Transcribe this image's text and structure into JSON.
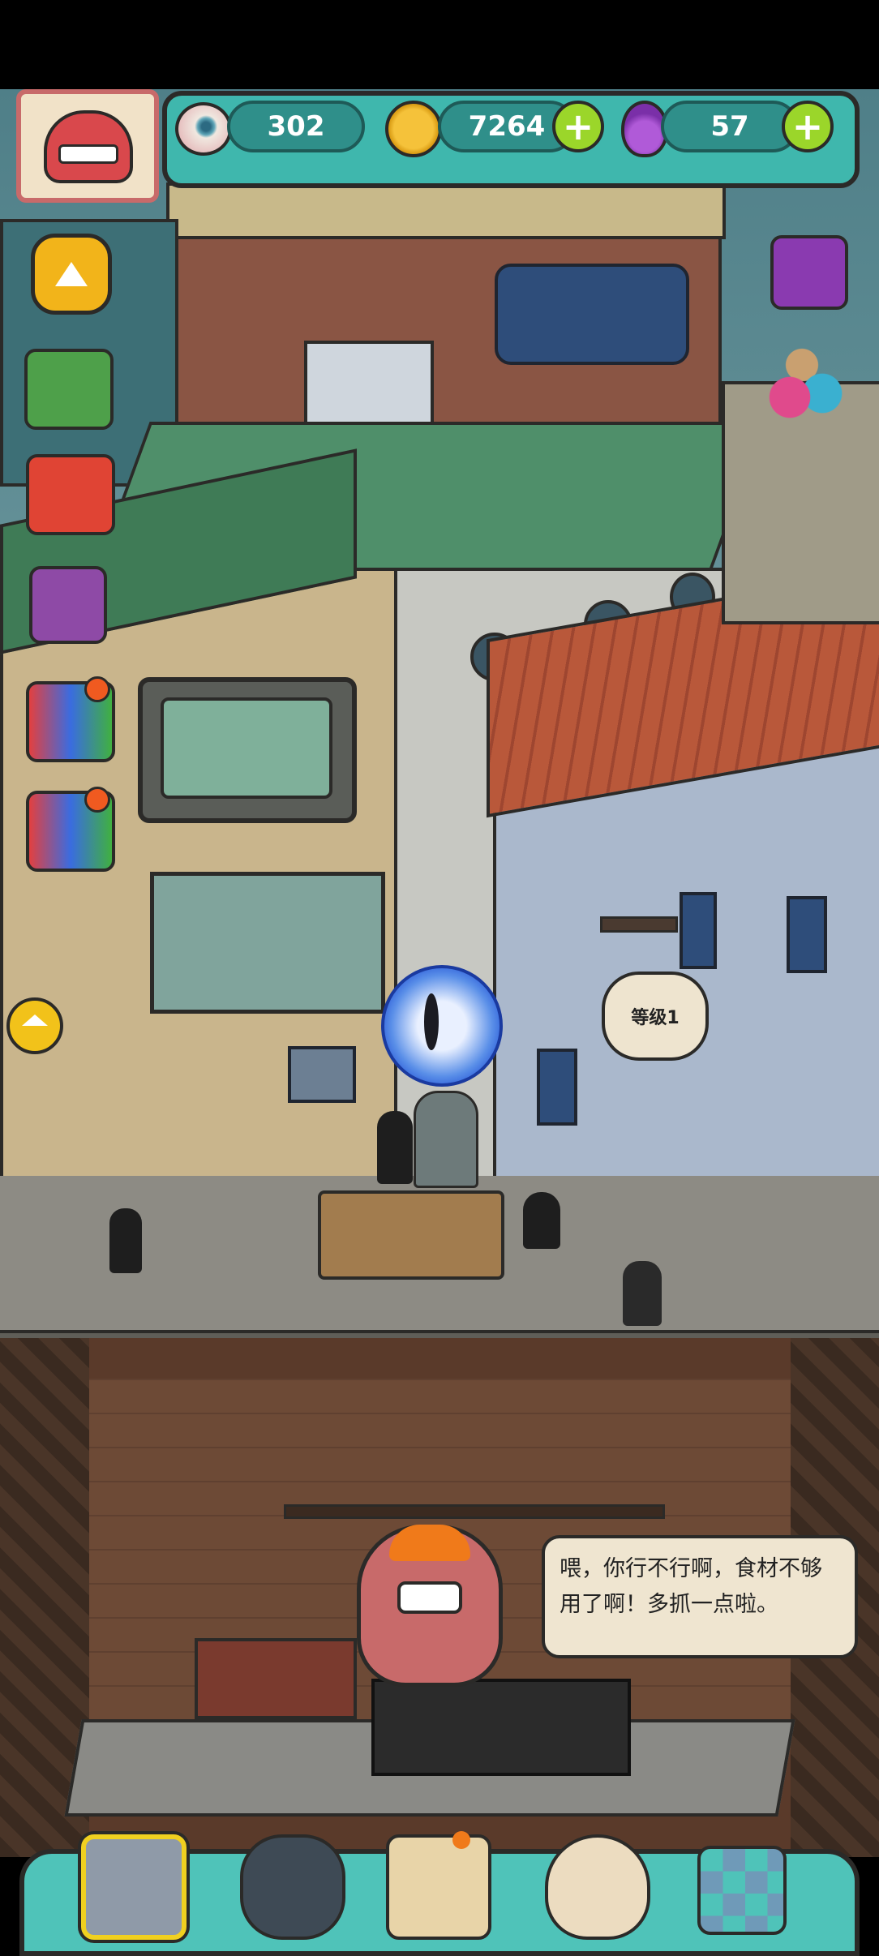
{
  "hud": {
    "eyeballs": "302",
    "coins": "7264",
    "potions": "57",
    "plus_symbol": "+"
  },
  "scene": {
    "level_bubble": "等级1",
    "chef_speech": "喂，你行不行啊，食材不够用了啊！多抓一点啦。"
  },
  "icons": {
    "avatar": "monster-avatar-icon",
    "eyeball": "eyeball-icon",
    "coin": "coin-icon",
    "potion": "potion-icon",
    "collapse": "chevron-up-icon",
    "home": "home-icon"
  },
  "nav": {
    "items": [
      "restaurant-tab",
      "monster-tab",
      "recipe-book-tab",
      "money-bag-tab",
      "grid-menu-tab"
    ],
    "selected_index": 0
  },
  "colors": {
    "hud_teal": "#3fb7ad",
    "plus_green": "#9bd62a",
    "pill_teal": "#2f8f8a",
    "dark_outline": "#2b2a28",
    "speech_bg": "#efe5d0",
    "selected_tab_border": "#f0d020"
  }
}
